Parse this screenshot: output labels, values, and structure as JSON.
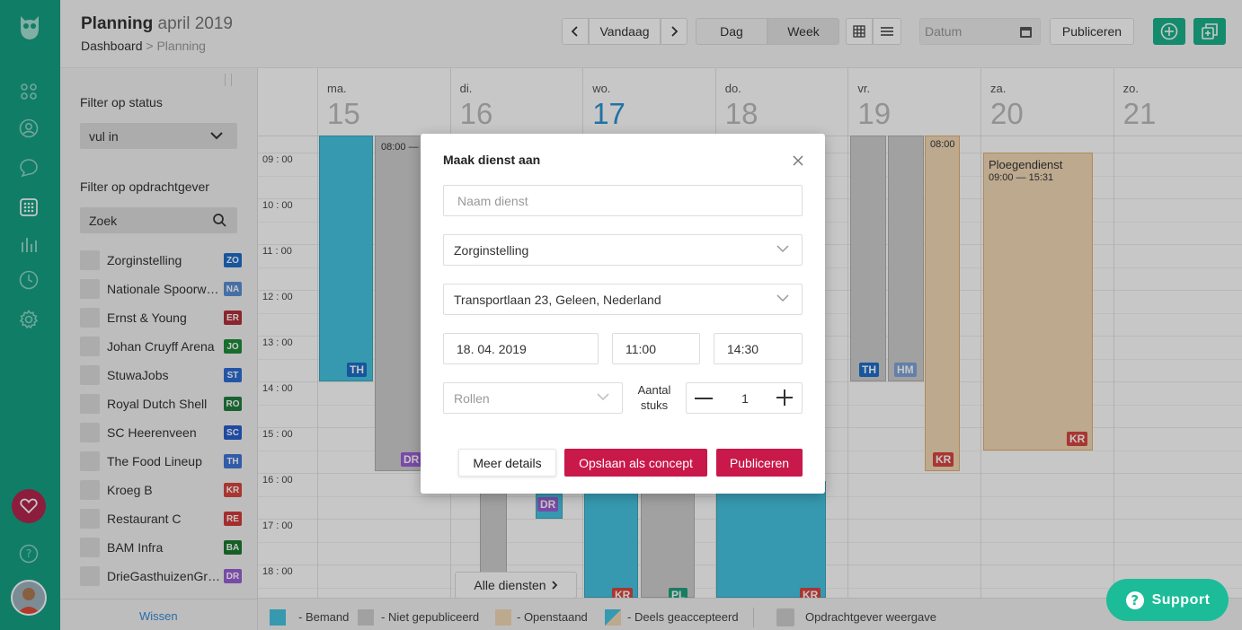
{
  "header": {
    "title": "Planning",
    "title_period": "april 2019",
    "breadcrumb_root": "Dashboard",
    "breadcrumb_sep": ">",
    "breadcrumb_current": "Planning",
    "today_label": "Vandaag",
    "view_day": "Dag",
    "view_week": "Week",
    "date_placeholder": "Datum",
    "publish_label": "Publiceren"
  },
  "filters": {
    "status_title": "Filter op status",
    "status_value": "vul in",
    "client_title": "Filter op opdrachtgever",
    "search_placeholder": "Zoek",
    "clear_label": "Wissen",
    "clients": [
      {
        "name": "Zorginstelling",
        "code": "ZO",
        "color": "#1e6fc9"
      },
      {
        "name": "Nationale Spoorwe…",
        "code": "NA",
        "color": "#5b8fd6"
      },
      {
        "name": "Ernst & Young",
        "code": "ER",
        "color": "#b2303c"
      },
      {
        "name": "Johan Cruyff Arena",
        "code": "JO",
        "color": "#1f8c3a"
      },
      {
        "name": "StuwaJobs",
        "code": "ST",
        "color": "#2d6ed6"
      },
      {
        "name": "Royal Dutch Shell",
        "code": "RO",
        "color": "#1f7f3f"
      },
      {
        "name": "SC Heerenveen",
        "code": "SC",
        "color": "#2a5fcf"
      },
      {
        "name": "The Food Lineup",
        "code": "TH",
        "color": "#3f76d9"
      },
      {
        "name": "Kroeg B",
        "code": "KR",
        "color": "#d9463f"
      },
      {
        "name": "Restaurant C",
        "code": "RE",
        "color": "#d43a3a"
      },
      {
        "name": "BAM Infra",
        "code": "BA",
        "color": "#1b7a33"
      },
      {
        "name": "DrieGasthuizenGr…",
        "code": "DR",
        "color": "#9b5fd6"
      }
    ]
  },
  "calendar": {
    "days": [
      {
        "name": "ma.",
        "num": "15"
      },
      {
        "name": "di.",
        "num": "16"
      },
      {
        "name": "wo.",
        "num": "17"
      },
      {
        "name": "do.",
        "num": "18"
      },
      {
        "name": "vr.",
        "num": "19"
      },
      {
        "name": "za.",
        "num": "20"
      },
      {
        "name": "zo.",
        "num": "21"
      }
    ],
    "times": [
      "09 : 00",
      "10 : 00",
      "11 : 00",
      "12 : 00",
      "13 : 00",
      "14 : 00",
      "15 : 00",
      "16 : 00",
      "17 : 00",
      "18 : 00"
    ],
    "events": {
      "mon_start": "08:00 —",
      "fri_start": "08:00",
      "sat_title": "Ploegendienst",
      "sat_time": "09:00 — 15:31",
      "badge_th": "TH",
      "badge_dr": "DR",
      "badge_hm": "HM",
      "badge_kr": "KR",
      "badge_pl": "PL"
    },
    "all_shifts": "Alle diensten"
  },
  "legend": {
    "staffed": "- Bemand",
    "unpublished": "- Niet gepubliceerd",
    "open": "- Openstaand",
    "partial": "- Deels geaccepteerd",
    "client_view": "Opdrachtgever weergave"
  },
  "modal": {
    "title": "Maak dienst aan",
    "name_placeholder": "Naam dienst",
    "client_value": "Zorginstelling",
    "address_value": "Transportlaan 23, Geleen, Nederland",
    "date_value": "18. 04. 2019",
    "start_value": "11:00",
    "end_value": "14:30",
    "roles_placeholder": "Rollen",
    "count_label": "Aantal stuks",
    "count_value": "1",
    "more_details": "Meer details",
    "save_concept": "Opslaan als concept",
    "publish": "Publiceren"
  },
  "support_label": "Support",
  "colors": {
    "sidebar": "#15a185",
    "accent_green": "#1ab28c",
    "primary_red": "#c9184a",
    "staffed": "#46c4e0",
    "unpublished": "#cfcfcf",
    "open": "#f3d9b6"
  }
}
